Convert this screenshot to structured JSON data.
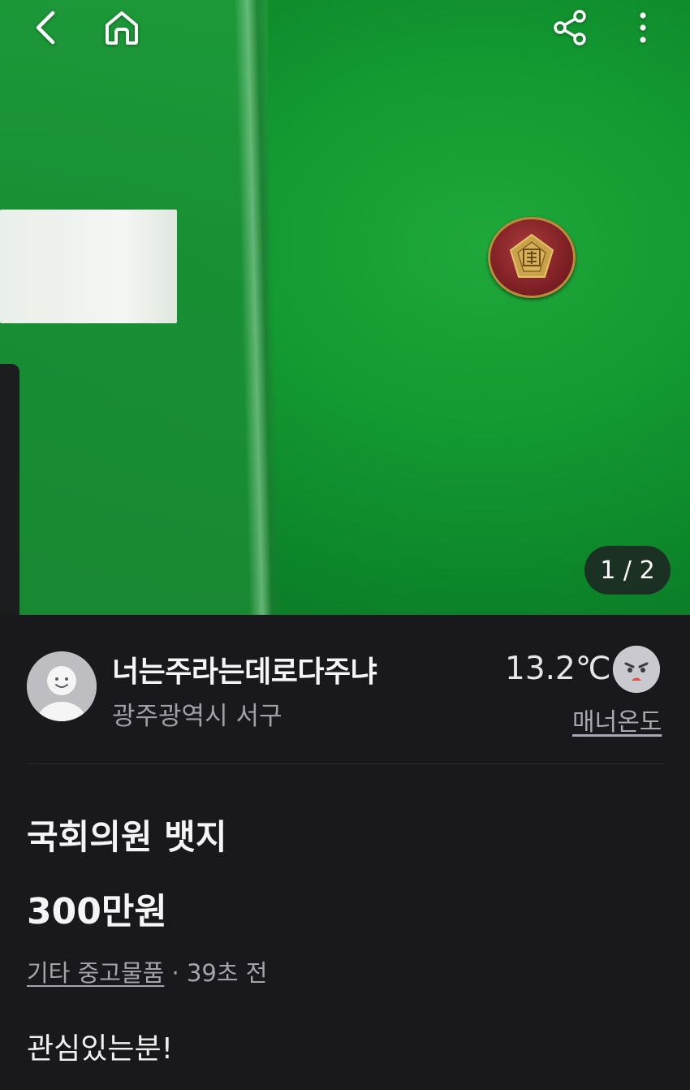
{
  "icons": {
    "back": "chevron-left-icon",
    "home": "home-icon",
    "share": "share-icon",
    "more": "more-vertical-icon",
    "profile": "user-avatar-icon",
    "manner_face": "angry-face-icon"
  },
  "photo": {
    "counter": "1 / 2",
    "current": 1,
    "total": 2
  },
  "seller": {
    "name": "너는주라는데로다주냐",
    "location": "광주광역시 서구",
    "temperature": "13.2℃",
    "manner_label": "매너온도"
  },
  "item": {
    "title": "국회의원 뱃지",
    "price": "300만원",
    "category": "기타 중고물품",
    "separator": " · ",
    "time_ago": "39초 전",
    "description": "관심있는분!"
  },
  "colors": {
    "background": "#18181d",
    "text_primary": "#f5f5f7",
    "text_secondary": "#a0a0a8",
    "felt_green": "#139a31"
  }
}
